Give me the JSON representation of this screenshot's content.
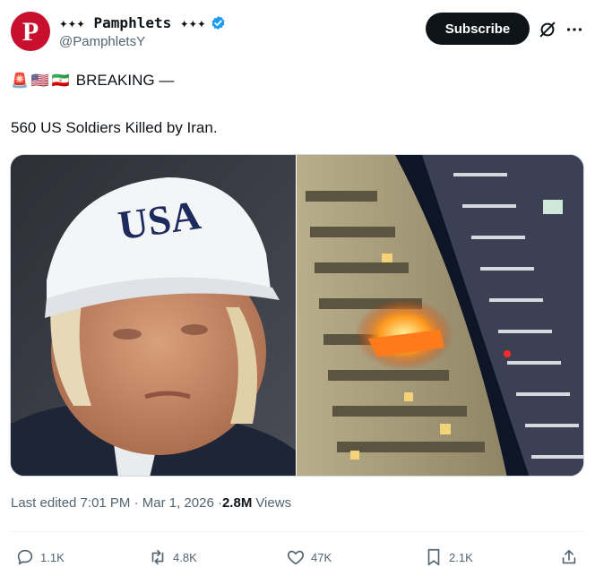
{
  "author": {
    "avatar_letter": "P",
    "display_name": "✦✦✦ Pamphlets ✦✦✦",
    "handle": "@PamphletsY",
    "avatar_color": "#c8102e",
    "verified_color": "#1d9bf0"
  },
  "header": {
    "subscribe_label": "Subscribe"
  },
  "tweet": {
    "emojis": [
      "🚨",
      "🇺🇸",
      "🇮🇷"
    ],
    "breaking_text": "BREAKING —",
    "body_text": "560 US Soldiers Killed by Iran.",
    "images": [
      {
        "description_icon": "photo-man-usa-cap",
        "cap_text": "USA"
      },
      {
        "description_icon": "photo-building-fire"
      }
    ]
  },
  "meta": {
    "edited_text": "Last edited 7:01 PM · Mar 1, 2026 · ",
    "views_count": "2.8M",
    "views_label": "Views"
  },
  "actions": {
    "replies": "1.1K",
    "reposts": "4.8K",
    "likes": "47K",
    "bookmarks": "2.1K"
  }
}
